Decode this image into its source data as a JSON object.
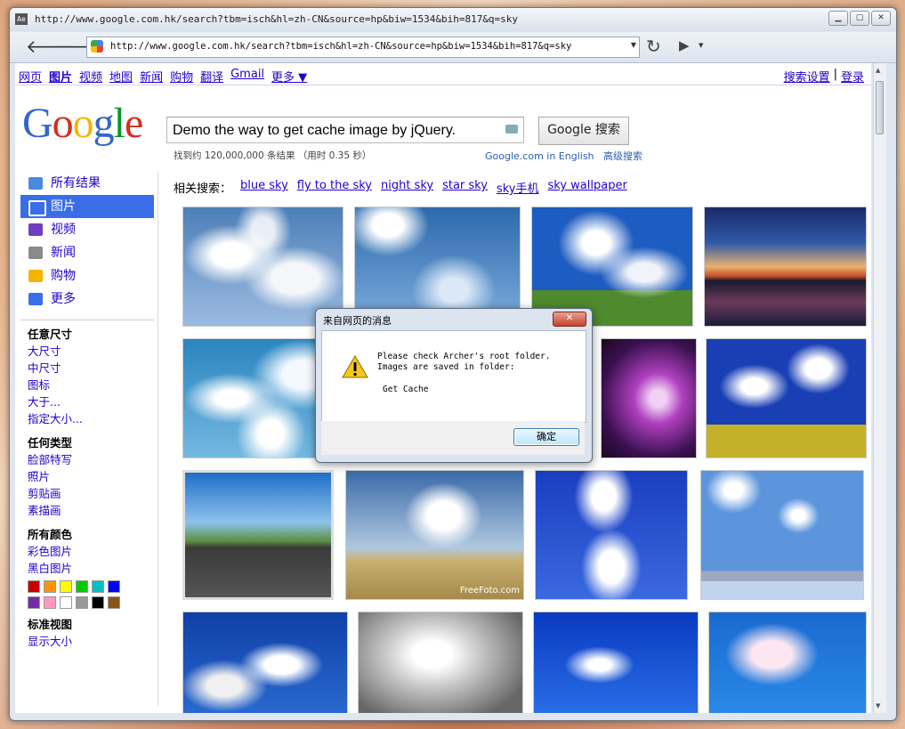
{
  "window": {
    "title": "http://www.google.com.hk/search?tbm=isch&hl=zh-CN&source=hp&biw=1534&bih=817&q=sky",
    "app_icon": "Ae",
    "controls": [
      "minimize-icon",
      "maximize-icon",
      "close-icon"
    ]
  },
  "toolbar": {
    "url": "http://www.google.com.hk/search?tbm=isch&hl=zh-CN&source=hp&biw=1534&bih=817&q=sky",
    "icons": [
      "back-icon",
      "forward-icon",
      "reload-icon",
      "go-icon"
    ]
  },
  "topnav": {
    "links": [
      "网页",
      "图片",
      "视频",
      "地图",
      "新闻",
      "购物",
      "翻译",
      "Gmail",
      "更多 ▼"
    ],
    "current": "图片",
    "settings": "搜索设置",
    "sep": "|",
    "login": "登录"
  },
  "search": {
    "query": "Demo the way to get cache image by jQuery.",
    "button": "Google 搜索",
    "stats": "找到约 120,000,000 条结果 （用时 0.35 秒）",
    "english_link": "Google.com in English",
    "advanced_link": "高级搜索"
  },
  "logo": [
    "G",
    "o",
    "o",
    "g",
    "l",
    "e"
  ],
  "left_nav": {
    "items": [
      {
        "label": "所有结果",
        "icon": "google-icon",
        "color": "#4a8ae0"
      },
      {
        "label": "图片",
        "icon": "camera-icon",
        "color": "#ffffff",
        "selected": true
      },
      {
        "label": "视频",
        "icon": "video-icon",
        "color": "#6f3fbf"
      },
      {
        "label": "新闻",
        "icon": "news-icon",
        "color": "#8a8a8a"
      },
      {
        "label": "购物",
        "icon": "tag-icon",
        "color": "#f5b400"
      },
      {
        "label": "更多",
        "icon": "more-icon",
        "color": "#3a6ee8"
      }
    ],
    "size_heading": "任意尺寸",
    "size_links": [
      "大尺寸",
      "中尺寸",
      "图标",
      "大于...",
      "指定大小..."
    ],
    "type_heading": "任何类型",
    "type_links": [
      "脸部特写",
      "照片",
      "剪贴画",
      "素描画"
    ],
    "color_heading": "所有颜色",
    "color_links": [
      "彩色图片",
      "黑白图片"
    ],
    "swatches": [
      "#cc0000",
      "#fb940b",
      "#ffff00",
      "#00cc00",
      "#03c0c6",
      "#0000ff",
      "#762ca7",
      "#ff98bf",
      "#ffffff",
      "#999999",
      "#000000",
      "#885418"
    ],
    "view_heading": "标准视图",
    "view_link": "显示大小"
  },
  "related": {
    "label": "相关搜索：",
    "links": [
      "blue sky",
      "fly to the sky",
      "night sky",
      "star sky",
      "sky手机",
      "sky wallpaper"
    ]
  },
  "results_watermark": "FreeFoto.com",
  "dialog": {
    "title": "来自网页的消息",
    "message": "Please check Archer's root folder.\nImages are saved in folder:",
    "sub": "Get Cache",
    "ok": "确定",
    "icon": "warning-icon"
  }
}
